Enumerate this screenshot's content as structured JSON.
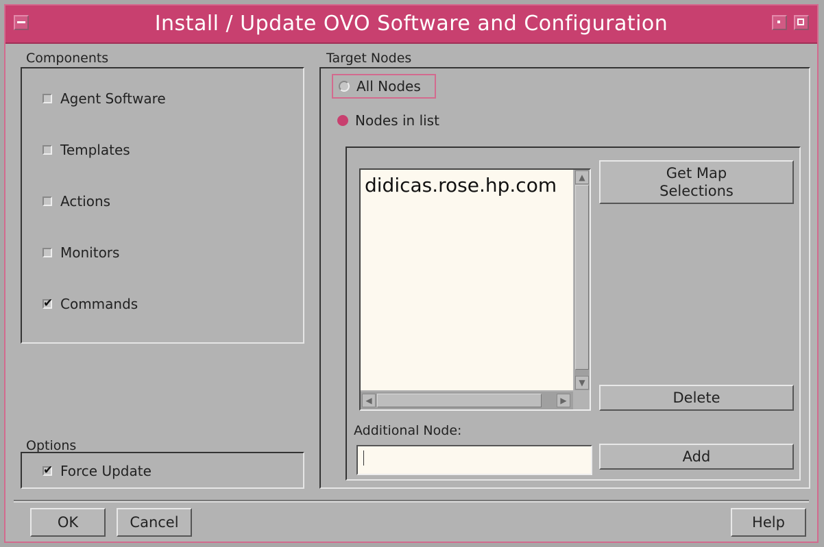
{
  "window": {
    "title": "Install / Update OVO Software and Configuration"
  },
  "components": {
    "label": "Components",
    "items": [
      {
        "label": "Agent Software",
        "checked": false
      },
      {
        "label": "Templates",
        "checked": false
      },
      {
        "label": "Actions",
        "checked": false
      },
      {
        "label": "Monitors",
        "checked": false
      },
      {
        "label": "Commands",
        "checked": true
      }
    ]
  },
  "options": {
    "label": "Options",
    "force_update": {
      "label": "Force Update",
      "checked": true
    }
  },
  "target_nodes": {
    "label": "Target Nodes",
    "all_nodes_label": "All Nodes",
    "nodes_in_list_label": "Nodes in list",
    "selected": "nodes_in_list",
    "node_list": [
      "didicas.rose.hp.com"
    ],
    "get_map_selections_label": "Get Map\nSelections",
    "delete_label": "Delete",
    "additional_node_label": "Additional Node:",
    "additional_node_value": "",
    "add_label": "Add"
  },
  "footer": {
    "ok_label": "OK",
    "cancel_label": "Cancel",
    "help_label": "Help"
  },
  "colors": {
    "accent": "#c8406f",
    "background": "#b3b3b3",
    "list_background": "#fdf9ef"
  }
}
